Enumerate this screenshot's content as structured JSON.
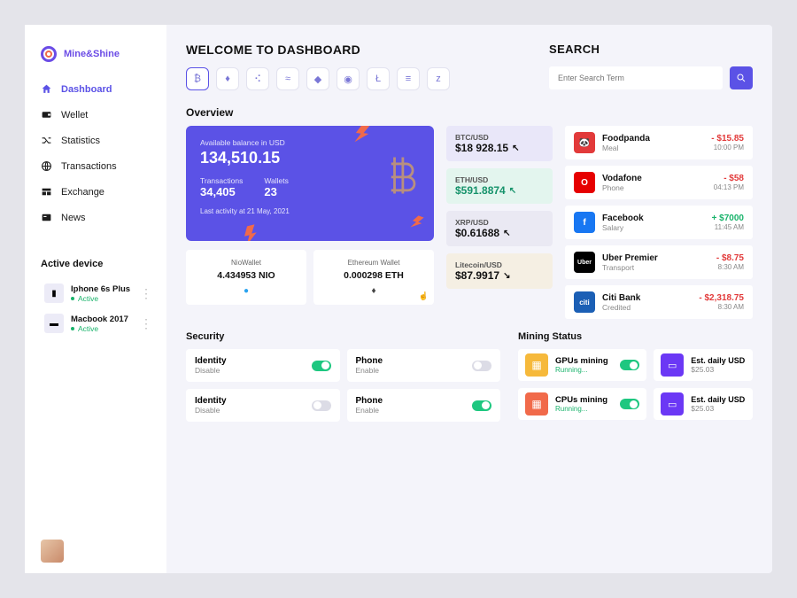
{
  "brand": {
    "name": "Mine&Shine"
  },
  "nav": {
    "items": [
      {
        "label": "Dashboard"
      },
      {
        "label": "Wellet"
      },
      {
        "label": "Statistics"
      },
      {
        "label": "Transactions"
      },
      {
        "label": "Exchange"
      },
      {
        "label": "News"
      }
    ]
  },
  "devices": {
    "heading": "Active device",
    "list": [
      {
        "name": "Iphone 6s Plus",
        "status": "Active"
      },
      {
        "name": "Macbook 2017",
        "status": "Active"
      }
    ]
  },
  "welcome": {
    "title": "WELCOME TO DASHBOARD"
  },
  "coinchips": [
    "₿",
    "♦",
    "⠪",
    "≈",
    "◆",
    "◉",
    "Ł",
    "≡",
    "z"
  ],
  "search": {
    "title": "SEARCH",
    "placeholder": "Enter Search Term"
  },
  "overview": {
    "heading": "Overview",
    "balance": {
      "label": "Available balance in USD",
      "value": "134,510.15",
      "tx_label": "Transactions",
      "tx_value": "34,405",
      "wl_label": "Wallets",
      "wl_value": "23",
      "last": "Last activity at 21 May, 2021"
    },
    "wallets": [
      {
        "name": "NioWallet",
        "value": "4.434953 NIO",
        "coin_color": "#2aa3ef"
      },
      {
        "name": "Ethereum Wallet",
        "value": "0.000298 ETH",
        "coin_color": "#333"
      }
    ]
  },
  "pairs": [
    {
      "label": "BTC/USD",
      "value": "$18 928.15",
      "dir": "↖"
    },
    {
      "label": "ETH/USD",
      "value": "$591.8874",
      "dir": "↖"
    },
    {
      "label": "XRP/USD",
      "value": "$0.61688",
      "dir": "↖"
    },
    {
      "label": "Litecoin/USD",
      "value": "$87.9917",
      "dir": "↘"
    }
  ],
  "tx": [
    {
      "name": "Foodpanda",
      "cat": "Meal",
      "amt": "- $15.85",
      "time": "10:00 PM",
      "sign": "neg",
      "bg": "#e23a3a",
      "ico": "🐼"
    },
    {
      "name": "Vodafone",
      "cat": "Phone",
      "amt": "- $58",
      "time": "04:13 PM",
      "sign": "neg",
      "bg": "#e60000",
      "ico": "O"
    },
    {
      "name": "Facebook",
      "cat": "Salary",
      "amt": "+ $7000",
      "time": "11:45 AM",
      "sign": "pos",
      "bg": "#1877f2",
      "ico": "f"
    },
    {
      "name": "Uber Premier",
      "cat": "Transport",
      "amt": "- $8.75",
      "time": "8:30 AM",
      "sign": "neg",
      "bg": "#000000",
      "ico": "Uber"
    },
    {
      "name": "Citi Bank",
      "cat": "Credited",
      "amt": "- $2,318.75",
      "time": "8:30 AM",
      "sign": "neg",
      "bg": "#1b5fb5",
      "ico": "citi"
    }
  ],
  "security": {
    "heading": "Security",
    "cards": [
      {
        "name": "Identity",
        "sub": "Disable",
        "on": true
      },
      {
        "name": "Phone",
        "sub": "Enable",
        "on": false
      },
      {
        "name": "Identity",
        "sub": "Disable",
        "on": false
      },
      {
        "name": "Phone",
        "sub": "Enable",
        "on": true
      }
    ]
  },
  "mining": {
    "heading": "Mining Status",
    "rows": [
      {
        "name": "GPUs mining",
        "sub": "Running...",
        "icobg": "y"
      },
      {
        "name": "CPUs mining",
        "sub": "Running...",
        "icobg": "o"
      }
    ],
    "est": [
      {
        "name": "Est. daily USD",
        "val": "$25.03"
      },
      {
        "name": "Est. daily USD",
        "val": "$25.03"
      }
    ]
  }
}
